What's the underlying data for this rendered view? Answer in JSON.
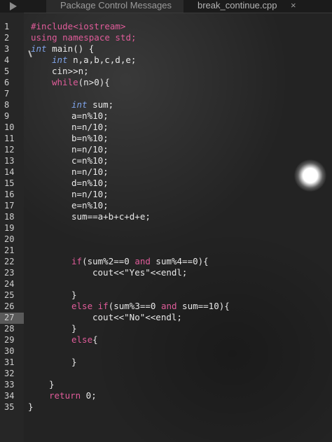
{
  "tabs": [
    {
      "label": "Package Control Messages"
    },
    {
      "label": "break_continue.cpp"
    }
  ],
  "tab_close_glyph": "×",
  "line_numbers": [
    "1",
    "2",
    "3",
    "4",
    "5",
    "6",
    "7",
    "8",
    "9",
    "10",
    "11",
    "12",
    "13",
    "14",
    "15",
    "16",
    "17",
    "18",
    "19",
    "20",
    "21",
    "22",
    "23",
    "24",
    "25",
    "26",
    "27",
    "28",
    "29",
    "30",
    "31",
    "32",
    "33",
    "34",
    "35"
  ],
  "code": {
    "l1_include": "#include<iostream>",
    "l2_using": "using namespace std;",
    "l3_int": "int",
    "l3_rest": " main() {",
    "l4_int": "int",
    "l4_rest": " n,a,b,c,d,e;",
    "l5": "cin>>n;",
    "l6_while": "while",
    "l6_rest": "(n>0){",
    "l8_int": "int",
    "l8_rest": " sum;",
    "l9": "a=n%10;",
    "l10": "n=n/10;",
    "l11": "b=n%10;",
    "l12": "n=n/10;",
    "l13": "c=n%10;",
    "l14": "n=n/10;",
    "l15": "d=n%10;",
    "l16": "n=n/10;",
    "l17": "e=n%10;",
    "l18": "sum==a+b+c+d+e;",
    "l22_if": "if",
    "l22_a": "(sum%2==0 ",
    "l22_and": "and",
    "l22_b": " sum%4==0){",
    "l23": "cout<<\"Yes\"<<endl;",
    "l25": "}",
    "l26_else": "else if",
    "l26_a": "(sum%3==0 ",
    "l26_and": "and",
    "l26_b": " sum==10){",
    "l27": "cout<<\"No\"<<endl;",
    "l28": "}",
    "l29_else": "else",
    "l29_rest": "{",
    "l31": "}",
    "l33": "}",
    "l34_return": "return",
    "l34_rest": " 0;",
    "l35": "}"
  }
}
